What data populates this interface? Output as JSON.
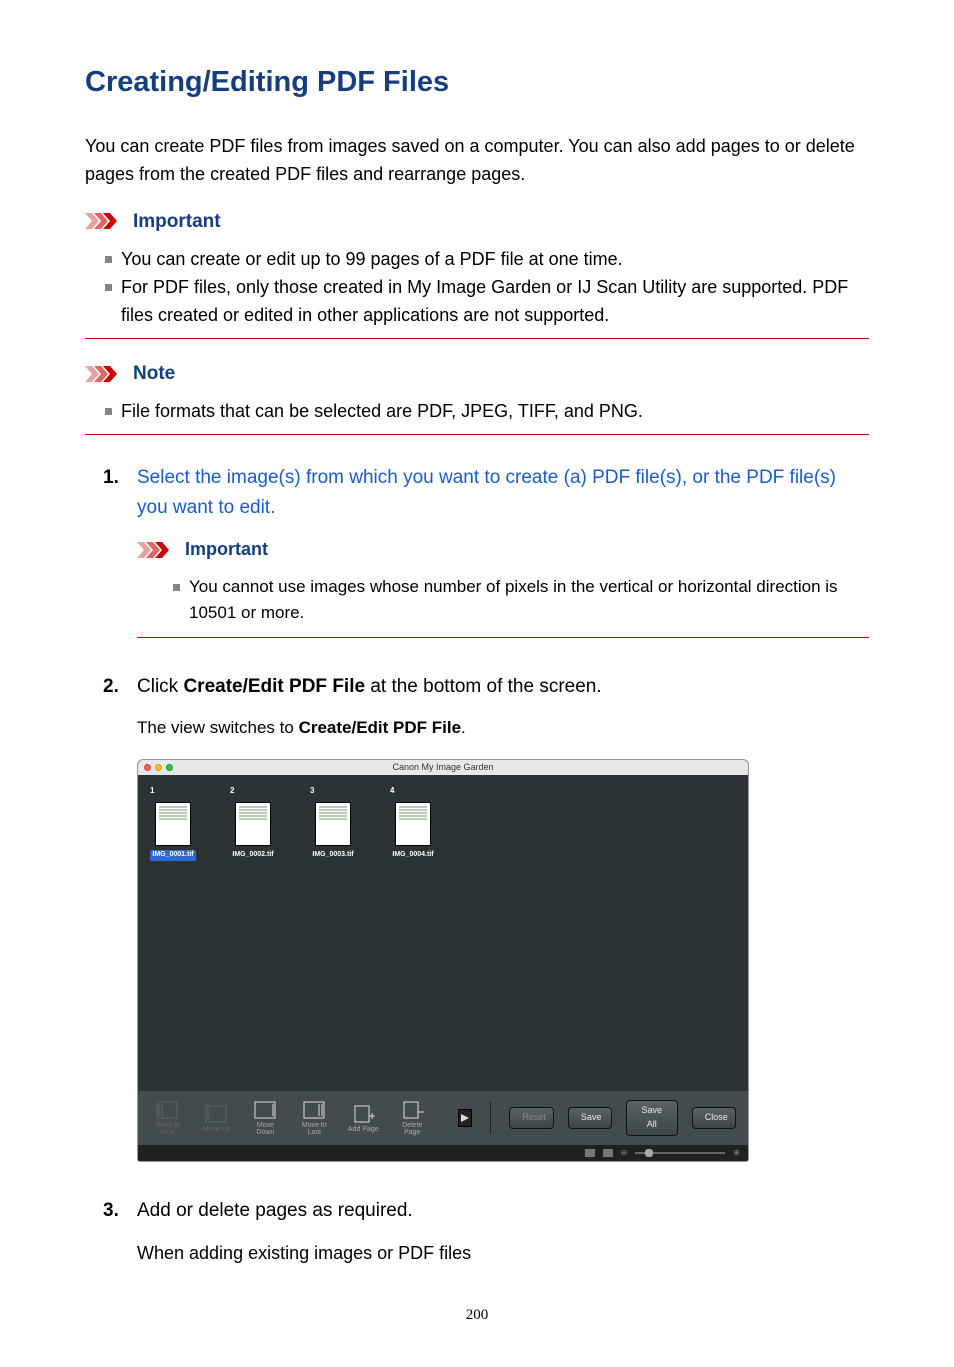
{
  "title": "Creating/Editing PDF Files",
  "intro": "You can create PDF files from images saved on a computer. You can also add pages to or delete pages from the created PDF files and rearrange pages.",
  "important1": {
    "label": "Important",
    "items": [
      "You can create or edit up to 99 pages of a PDF file at one time.",
      "For PDF files, only those created in My Image Garden or IJ Scan Utility are supported. PDF files created or edited in other applications are not supported."
    ]
  },
  "note1": {
    "label": "Note",
    "items": [
      "File formats that can be selected are PDF, JPEG, TIFF, and PNG."
    ]
  },
  "steps": {
    "s1": {
      "text": "Select the image(s) from which you want to create (a) PDF file(s), or the PDF file(s) you want to edit.",
      "important": {
        "label": "Important",
        "item": "You cannot use images whose number of pixels in the vertical or horizontal direction is 10501 or more."
      }
    },
    "s2": {
      "pre": "Click ",
      "bold": "Create/Edit PDF File",
      "post": " at the bottom of the screen.",
      "sub_pre": "The view switches to ",
      "sub_bold": "Create/Edit PDF File",
      "sub_post": "."
    },
    "s3": {
      "text": "Add or delete pages as required.",
      "sub": "When adding existing images or PDF files"
    }
  },
  "app": {
    "title": "Canon My Image Garden",
    "thumbs": [
      {
        "n": "1",
        "name": "IMG_0001.tif",
        "selected": true
      },
      {
        "n": "2",
        "name": "IMG_0002.tif",
        "selected": false
      },
      {
        "n": "3",
        "name": "IMG_0003.tif",
        "selected": false
      },
      {
        "n": "4",
        "name": "IMG_0004.tif",
        "selected": false
      }
    ],
    "toolbar": {
      "move_first": "Move to First",
      "move_up": "Move Up",
      "move_down": "Move Down",
      "move_last": "Move to Last",
      "add_page": "Add Page",
      "delete_page": "Delete Page",
      "reset": "Reset",
      "save": "Save",
      "save_all": "Save All",
      "close": "Close"
    }
  },
  "page_number": "200"
}
